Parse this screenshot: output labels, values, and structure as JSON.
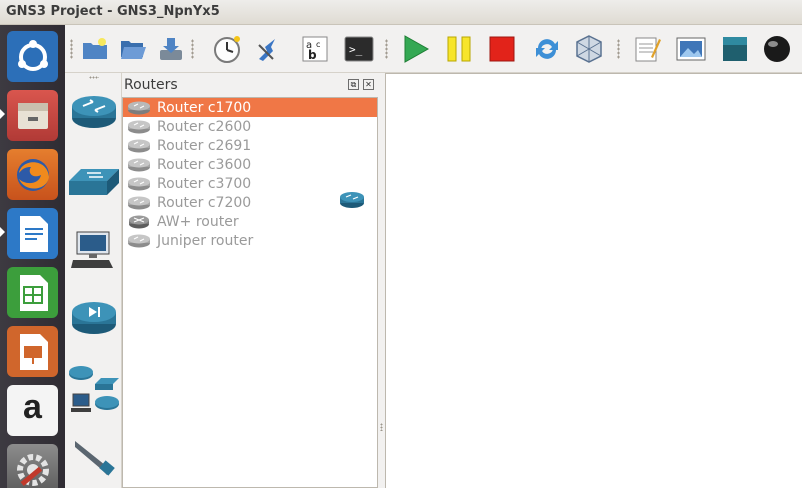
{
  "window": {
    "title": "GNS3 Project - GNS3_NpnYx5"
  },
  "launcher": {
    "items": [
      {
        "name": "ubuntu-dash-icon",
        "color": "#2c6fb8"
      },
      {
        "name": "files-icon",
        "color": "#c7504b"
      },
      {
        "name": "firefox-icon",
        "color": "#e8711c"
      },
      {
        "name": "writer-icon",
        "color": "#2d79c7"
      },
      {
        "name": "calc-icon",
        "color": "#3c9e3c"
      },
      {
        "name": "impress-icon",
        "color": "#d0662c"
      },
      {
        "name": "amazon-icon",
        "color": "#f4f4f4",
        "glyph": "a"
      },
      {
        "name": "settings-icon",
        "color": "#c4c4c4"
      }
    ]
  },
  "toolbar": {
    "buttons": [
      "new-project-icon",
      "open-project-icon",
      "save-project-icon",
      "snapshot-icon",
      "connection-icon",
      "label-icon",
      "console-icon",
      "start-icon",
      "suspend-icon",
      "stop-icon",
      "reload-icon",
      "virtualbox-icon",
      "note-icon",
      "image-icon",
      "rectangle-icon",
      "ellipse-icon"
    ],
    "console_glyph": ">_"
  },
  "device_types": [
    "routers-category-icon",
    "switches-category-icon",
    "end-devices-category-icon",
    "security-devices-category-icon",
    "all-devices-category-icon",
    "link-category-icon"
  ],
  "dock": {
    "title": "Routers",
    "float_glyph": "⧉",
    "close_glyph": "✕",
    "items": [
      {
        "label": "Router c1700",
        "selected": true
      },
      {
        "label": "Router c2600",
        "selected": false
      },
      {
        "label": "Router c2691",
        "selected": false
      },
      {
        "label": "Router c3600",
        "selected": false
      },
      {
        "label": "Router c3700",
        "selected": false
      },
      {
        "label": "Router c7200",
        "selected": false
      },
      {
        "label": "AW+ router",
        "selected": false
      },
      {
        "label": "Juniper router",
        "selected": false
      }
    ]
  },
  "colors": {
    "selection": "#f07746",
    "launcher_bg": "#34313a",
    "router_blue": "#2a6f8e"
  }
}
